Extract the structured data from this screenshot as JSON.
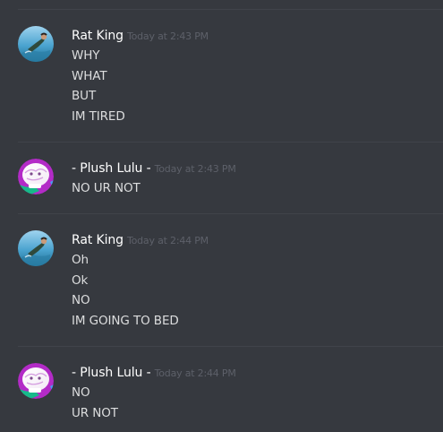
{
  "messages": [
    {
      "author": "Rat King",
      "timestamp": "Today at 2:43 PM",
      "avatar": "rat-king-avatar",
      "lines": [
        "WHY",
        "WHAT",
        "BUT",
        "IM TIRED"
      ]
    },
    {
      "author": "- Plush Lulu -",
      "timestamp": "Today at 2:43 PM",
      "avatar": "plush-lulu-avatar",
      "lines": [
        "NO UR NOT"
      ]
    },
    {
      "author": "Rat King",
      "timestamp": "Today at 2:44 PM",
      "avatar": "rat-king-avatar",
      "lines": [
        "Oh",
        "Ok",
        "NO",
        "IM GOING TO BED"
      ]
    },
    {
      "author": "- Plush Lulu -",
      "timestamp": "Today at 2:44 PM",
      "avatar": "plush-lulu-avatar",
      "lines": [
        "NO",
        "UR NOT"
      ]
    }
  ],
  "colors": {
    "background": "#36393f",
    "divider": "#40434a",
    "username": "#ffffff",
    "timestamp": "#5d6069",
    "message_text": "#dcddde"
  }
}
